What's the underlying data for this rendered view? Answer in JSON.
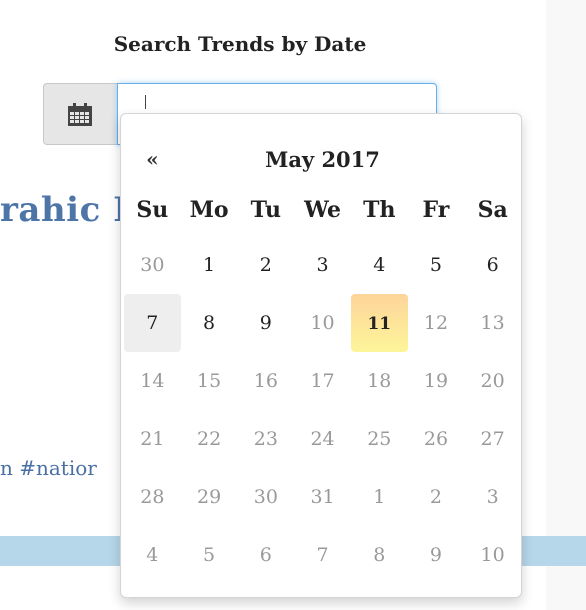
{
  "page": {
    "heading": "Search Trends by Date",
    "background_title_fragment": "rahic I",
    "background_tag_fragment": "n #natior"
  },
  "date_input": {
    "value": "",
    "placeholder": ""
  },
  "calendar": {
    "prev_symbol": "«",
    "month_label": "May 2017",
    "weekdays": [
      "Su",
      "Mo",
      "Tu",
      "We",
      "Th",
      "Fr",
      "Sa"
    ],
    "weeks": [
      [
        "30",
        "1",
        "2",
        "3",
        "4",
        "5",
        "6"
      ],
      [
        "7",
        "8",
        "9",
        "10",
        "11",
        "12",
        "13"
      ],
      [
        "14",
        "15",
        "16",
        "17",
        "18",
        "19",
        "20"
      ],
      [
        "21",
        "22",
        "23",
        "24",
        "25",
        "26",
        "27"
      ],
      [
        "28",
        "29",
        "30",
        "31",
        "1",
        "2",
        "3"
      ],
      [
        "4",
        "5",
        "6",
        "7",
        "8",
        "9",
        "10"
      ]
    ],
    "today": "11",
    "hovered_day": "7"
  },
  "colors": {
    "accent_blue": "#4d75a8",
    "input_focus": "#66afe9",
    "today_gradient_top": "#fdd49a",
    "today_gradient_bottom": "#fdf59a",
    "muted_day": "#999999",
    "bar": "#b6d7ea"
  }
}
